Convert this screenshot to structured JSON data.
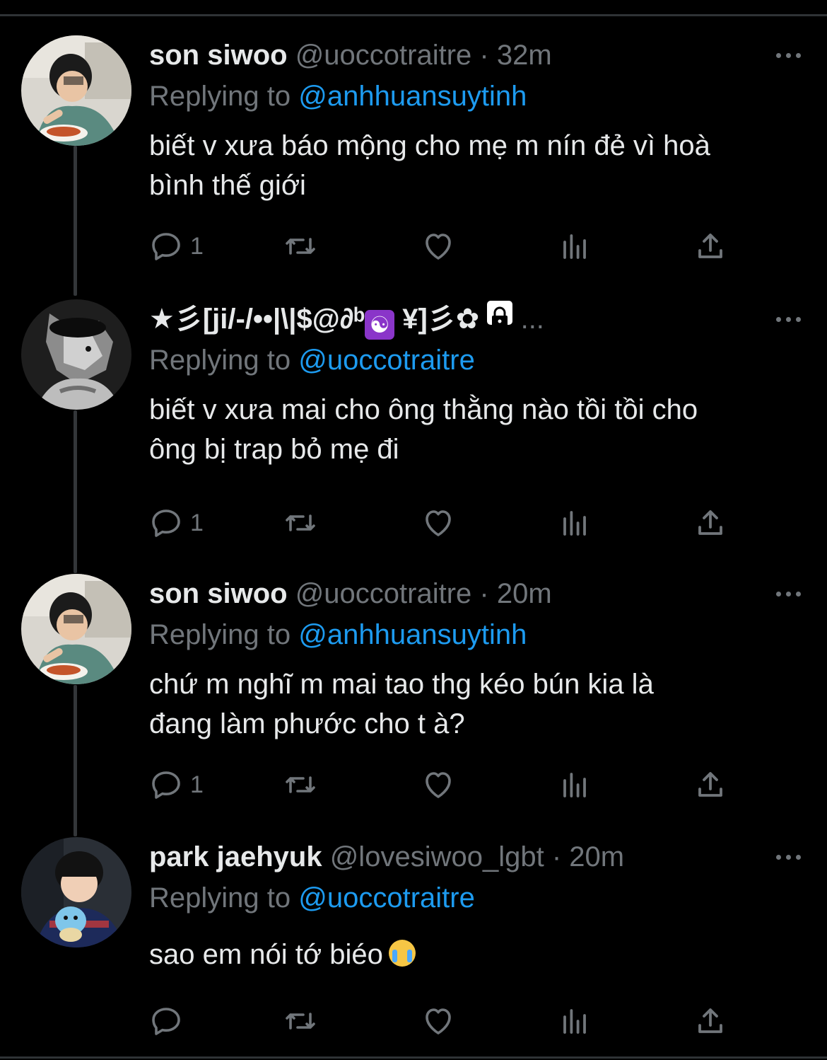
{
  "tweets": [
    {
      "name": "son siwoo",
      "handle": "@uoccotraitre",
      "separator": "·",
      "time": "32m",
      "replying_prefix": "Replying to",
      "replying_to": "@anhhuansuytinh",
      "text_lines": [
        "biết v xưa báo mộng cho mẹ m nín đẻ vì hoà",
        "bình thế giới"
      ],
      "reply_count": "1"
    },
    {
      "name_text": "★彡[ji/-/••|\\|$@∂ᵇ",
      "name_symbol": "☯",
      "name_text2": " ¥]彡✿",
      "name_ellipsis": " ...",
      "replying_prefix": "Replying to",
      "replying_to": "@uoccotraitre",
      "text_lines": [
        "biết v xưa mai cho ông thằng nào tồi tồi cho",
        "ông bị trap bỏ mẹ đi"
      ],
      "reply_count": "1"
    },
    {
      "name": "son siwoo",
      "handle": "@uoccotraitre",
      "separator": "·",
      "time": "20m",
      "replying_prefix": "Replying to",
      "replying_to": "@anhhuansuytinh",
      "text_lines": [
        "chứ m nghĩ m mai tao thg kéo bún kia là",
        "đang làm phước cho t à?"
      ],
      "reply_count": "1"
    },
    {
      "name": "park jaehyuk",
      "handle": "@lovesiwoo_lgbt",
      "separator": "·",
      "time": "20m",
      "replying_prefix": "Replying to",
      "replying_to": "@uoccotraitre",
      "text_lines": [
        "sao em nói tớ biéo"
      ],
      "reply_count": ""
    }
  ],
  "icons": {
    "reply": "reply-icon",
    "retweet": "retweet-icon",
    "like": "heart-icon",
    "views": "views-icon",
    "share": "share-icon",
    "more": "more-icon",
    "emoji": "loudly-crying-face-emoji"
  },
  "colors": {
    "background": "#000000",
    "text": "#e7e9ea",
    "secondary": "#71767b",
    "link": "#1d9bf0",
    "divider": "#2f3336"
  }
}
